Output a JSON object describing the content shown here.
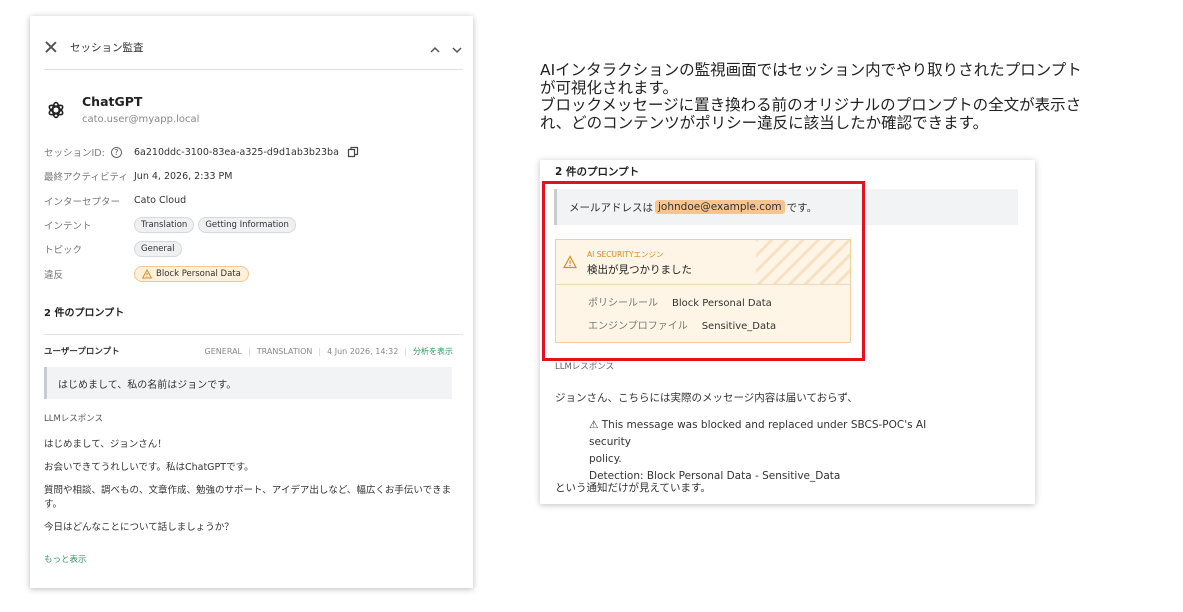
{
  "panel": {
    "title": "セッション監査",
    "app_name": "ChatGPT",
    "app_user": "cato.user@myapp.local",
    "meta": {
      "session_id_label": "セッションID:",
      "session_id": "6a210ddc-3100-83ea-a325-d9d1ab3b23ba",
      "last_activity_label": "最終アクティビティ",
      "last_activity": "Jun 4, 2026, 2:33 PM",
      "interceptor_label": "インターセプター",
      "interceptor": "Cato Cloud",
      "intent_label": "インテント",
      "intents": [
        "Translation",
        "Getting Information"
      ],
      "topic_label": "トピック",
      "topic": "General",
      "violation_label": "違反",
      "violation": "Block Personal Data"
    },
    "prompts_title": "2 件のプロンプト",
    "user_prompt": {
      "label": "ユーザープロンプト",
      "tag1": "GENERAL",
      "tag2": "TRANSLATION",
      "date": "4 Jun 2026, 14:32",
      "analyze_link": "分析を表示",
      "text": "はじめまして、私の名前はジョンです。"
    },
    "llm": {
      "label": "LLMレスポンス",
      "p1": "はじめまして、ジョンさん！",
      "p2": "お会いできてうれしいです。私はChatGPTです。",
      "p3": "質問や相談、調べもの、文章作成、勉強のサポート、アイデア出しなど、幅広くお手伝いできます。",
      "p4": "今日はどんなことについて話しましょうか？",
      "more": "もっと表示"
    }
  },
  "description": {
    "line1": "AIインタラクションの監視画面ではセッション内でやり取りされたプロンプト",
    "line2": "が可視化されます。",
    "line3": "ブロックメッセージに置き換わる前のオリジナルのプロンプトの全文が表示さ",
    "line4": "れ、どのコンテンツがポリシー違反に該当したか確認できます。"
  },
  "card": {
    "title": "2 件のプロンプト",
    "quote_pre": "メールアドレスは",
    "quote_email": "johndoe@example.com",
    "quote_post": "です。",
    "detection": {
      "engine": "AI SECURITYエンジン",
      "headline": "検出が見つかりました",
      "policy_rule_label": "ポリシールール",
      "policy_rule": "Block Personal Data",
      "engine_profile_label": "エンジンプロファイル",
      "engine_profile": "Sensitive_Data"
    },
    "llm_label": "LLMレスポンス",
    "p1": "ジョンさん、こちらには実際のメッセージ内容は届いておらず、",
    "block_line1": "⚠ This message was blocked and replaced under SBCS-POC's AI security",
    "block_line2": "policy.",
    "block_line3": "Detection: Block Personal Data - Sensitive_Data",
    "p2": "という通知だけが見えています。"
  },
  "colors": {
    "accent_green": "#2a9d5c",
    "highlight_red": "#e4121d",
    "warning_orange": "#e08a1e",
    "email_highlight": "#f6c48e"
  }
}
